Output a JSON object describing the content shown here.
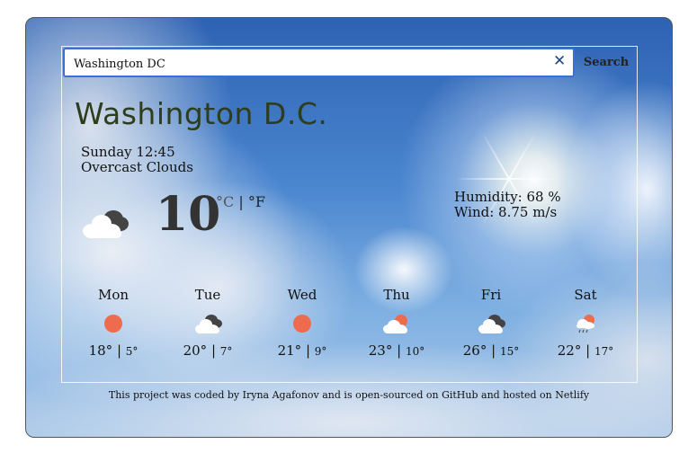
{
  "search": {
    "value": "Washington DC",
    "button_label": "Search"
  },
  "current": {
    "city": "Washington D.C.",
    "day_time": "Sunday 12:45",
    "description": "Overcast Clouds",
    "temperature": "10",
    "unit_celsius": "°C",
    "unit_separator": " | ",
    "unit_fahrenheit": "°F",
    "humidity": "Humidity: 68 %",
    "wind": "Wind: 8.75 m/s",
    "icon": "overcast-clouds-icon"
  },
  "forecast": [
    {
      "day": "Mon",
      "high": "18°",
      "low": "5°",
      "icon": "sun-icon"
    },
    {
      "day": "Tue",
      "high": "20°",
      "low": "7°",
      "icon": "broken-clouds-icon"
    },
    {
      "day": "Wed",
      "high": "21°",
      "low": "9°",
      "icon": "sun-icon"
    },
    {
      "day": "Thu",
      "high": "23°",
      "low": "10°",
      "icon": "partly-cloudy-icon"
    },
    {
      "day": "Fri",
      "high": "26°",
      "low": "15°",
      "icon": "broken-clouds-icon"
    },
    {
      "day": "Sat",
      "high": "22°",
      "low": "17°",
      "icon": "rain-cloud-sun-icon"
    }
  ],
  "temp_separator": " | ",
  "footer": {
    "text": "This project was coded by Iryna Agafonov and is open-sourced on GitHub and hosted on Netlify"
  },
  "colors": {
    "sun": "#ee6c4d",
    "cloud_dark": "#444444",
    "cloud_light": "#ffffff",
    "accent": "#3b6fd8"
  }
}
